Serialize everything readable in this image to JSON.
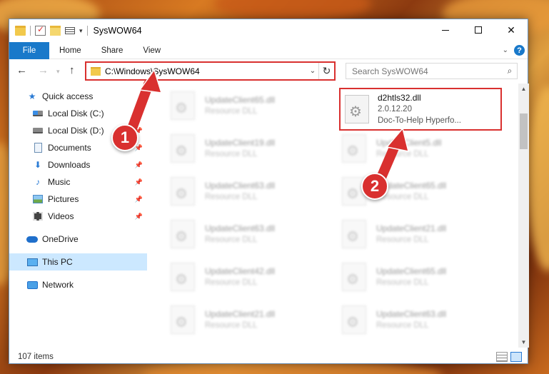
{
  "window": {
    "title": "SysWOW64"
  },
  "ribbon": {
    "tabs": [
      {
        "label": "File"
      },
      {
        "label": "Home"
      },
      {
        "label": "Share"
      },
      {
        "label": "View"
      }
    ]
  },
  "address": {
    "path": "C:\\Windows\\SysWOW64"
  },
  "search": {
    "placeholder": "Search SysWOW64"
  },
  "sidebar": {
    "items": [
      {
        "label": "Quick access",
        "icon": "star-icon"
      },
      {
        "label": "Local Disk (C:)",
        "icon": "drive-icon",
        "pinned": true
      },
      {
        "label": "Local Disk (D:)",
        "icon": "drive-icon",
        "pinned": true
      },
      {
        "label": "Documents",
        "icon": "documents-icon",
        "pinned": true
      },
      {
        "label": "Downloads",
        "icon": "downloads-icon",
        "pinned": true
      },
      {
        "label": "Music",
        "icon": "music-icon",
        "pinned": true
      },
      {
        "label": "Pictures",
        "icon": "pictures-icon",
        "pinned": true
      },
      {
        "label": "Videos",
        "icon": "videos-icon",
        "pinned": true
      },
      {
        "label": "OneDrive",
        "icon": "onedrive-icon"
      },
      {
        "label": "This PC",
        "icon": "this-pc-icon",
        "selected": true
      },
      {
        "label": "Network",
        "icon": "network-icon"
      }
    ]
  },
  "files": {
    "highlighted": {
      "name": "d2htls32.dll",
      "version": "2.0.12.20",
      "description": "Doc-To-Help Hyperfo..."
    },
    "left_column": [
      {
        "name": "UpdateClient65.dll",
        "type": "Resource DLL"
      },
      {
        "name": "UpdateClient19.dll",
        "type": "Resource DLL"
      },
      {
        "name": "UpdateClient63.dll",
        "type": "Resource DLL"
      },
      {
        "name": "UpdateClient63.dll",
        "type": "Resource DLL"
      },
      {
        "name": "UpdateClient42.dll",
        "type": "Resource DLL"
      },
      {
        "name": "UpdateClient21.dll",
        "type": "Resource DLL"
      }
    ],
    "right_column": [
      {
        "name": "UpdateClient5.dll",
        "type": "Resource DLL"
      },
      {
        "name": "UpdateClient65.dll",
        "type": "Resource DLL"
      },
      {
        "name": "UpdateClient21.dll",
        "type": "Resource DLL"
      },
      {
        "name": "UpdateClient65.dll",
        "type": "Resource DLL"
      },
      {
        "name": "UpdateClient63.dll",
        "type": "Resource DLL"
      }
    ]
  },
  "status": {
    "item_count": "107 items"
  },
  "annotations": {
    "step1": "1",
    "step2": "2",
    "color": "#d9302f"
  }
}
